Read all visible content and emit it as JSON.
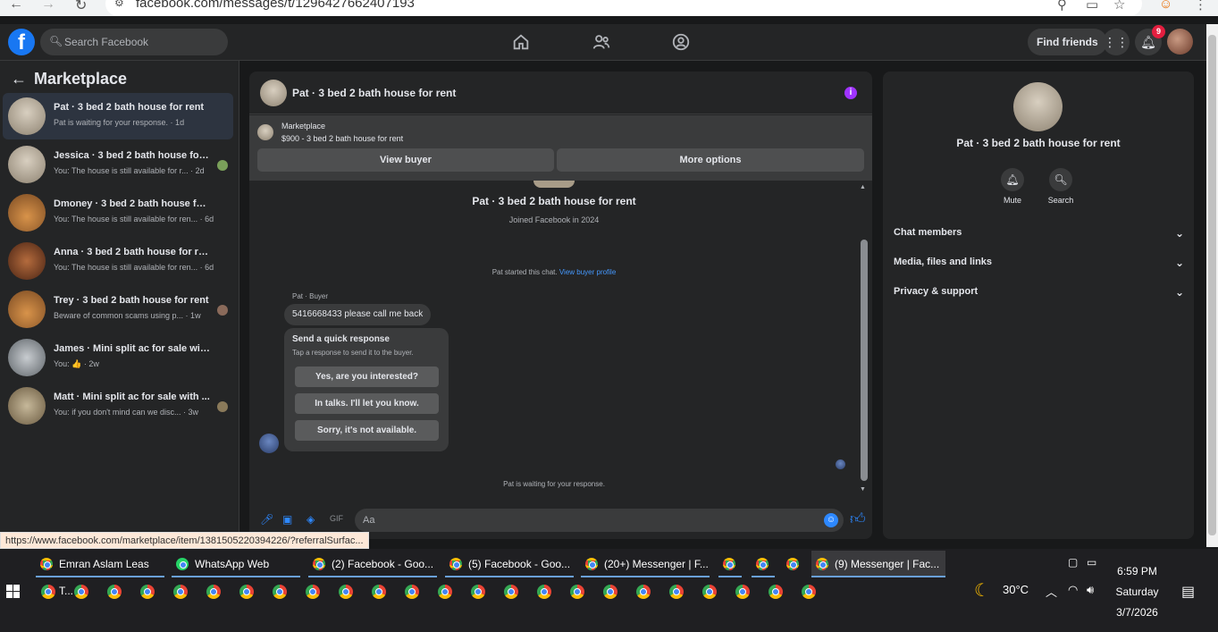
{
  "browser": {
    "url": "facebook.com/messages/t/1296427662407193"
  },
  "fb": {
    "search_placeholder": "Search Facebook",
    "find_friends": "Find friends",
    "notif_count": "9"
  },
  "sidebar": {
    "title": "Marketplace",
    "conversations": [
      {
        "title": "Pat · 3 bed 2 bath house for rent",
        "sub": "Pat is waiting for your response. · 1d"
      },
      {
        "title": "Jessica · 3 bed 2 bath house for ...",
        "sub": "You: The house is still available for r... · 2d"
      },
      {
        "title": "Dmoney · 3 bed 2 bath house for r...",
        "sub": "You: The house is still available for ren... · 6d"
      },
      {
        "title": "Anna · 3 bed 2 bath house for rent",
        "sub": "You: The house is still available for ren... · 6d"
      },
      {
        "title": "Trey · 3 bed 2 bath house for rent",
        "sub": "Beware of common scams using p... · 1w"
      },
      {
        "title": "James · Mini split ac for sale with i...",
        "sub": "You: 👍 · 2w"
      },
      {
        "title": "Matt · Mini split ac for sale with ...",
        "sub": "You: if you don't mind can we disc... · 3w"
      }
    ]
  },
  "chat": {
    "header_name": "Pat · 3 bed 2 bath house for rent",
    "marketplace_label": "Marketplace",
    "listing": "$900 - 3 bed 2 bath house for rent",
    "view_buyer": "View buyer",
    "more_options": "More options",
    "profile_name": "Pat · 3 bed 2 bath house for rent",
    "joined": "Joined Facebook in 2024",
    "started_text": "Pat started this chat. ",
    "view_buyer_profile": "View buyer profile",
    "sender_label": "Pat · Buyer",
    "message": "5416668433 please call me back",
    "quick_title": "Send a quick response",
    "quick_sub": "Tap a response to send it to the buyer.",
    "quick_responses": [
      "Yes, are you interested?",
      "In talks. I'll let you know.",
      "Sorry, it's not available."
    ],
    "waiting": "Pat is waiting for your response.",
    "composer_placeholder": "Aa"
  },
  "rpanel": {
    "name": "Pat · 3 bed 2 bath house for rent",
    "mute": "Mute",
    "search": "Search",
    "sections": [
      "Chat members",
      "Media, files and links",
      "Privacy & support"
    ]
  },
  "status_url": "https://www.facebook.com/marketplace/item/1381505220394226/?referralSurfac...",
  "taskbar": {
    "tabs": [
      "Emran Aslam Leas T...",
      "WhatsApp Web",
      "(2) Facebook - Goo...",
      "(5) Facebook - Goo...",
      "(20+) Messenger | F...",
      "(9) Messenger | Fac..."
    ],
    "weather": "30°C",
    "time": "6:59 PM",
    "day": "Saturday",
    "date": "3/7/2026"
  }
}
